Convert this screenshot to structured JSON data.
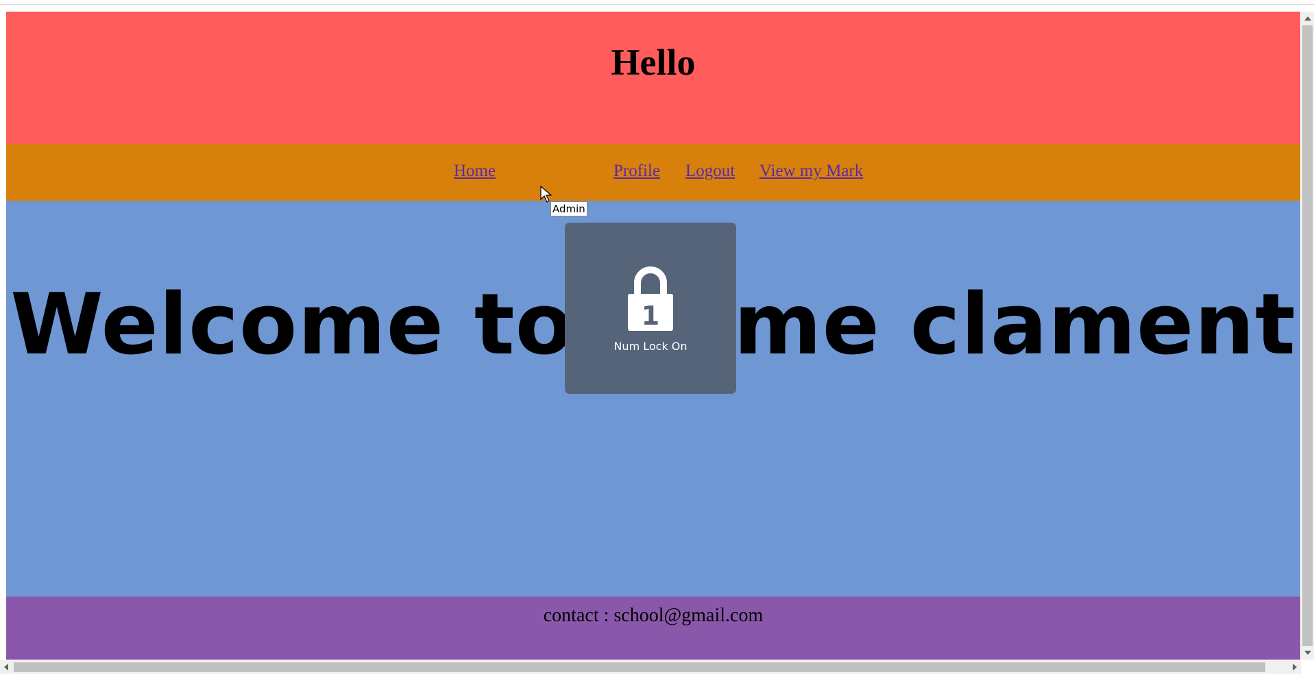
{
  "header": {
    "title": "Hello"
  },
  "nav": {
    "links": [
      {
        "label": "Home"
      },
      {
        "label": "Profile"
      },
      {
        "label": "Logout"
      },
      {
        "label": "View my Mark"
      }
    ],
    "tooltip": "Admin"
  },
  "main": {
    "heading": "Welcome to Home clament"
  },
  "osd": {
    "label": "Num Lock On",
    "icon": "lock-icon",
    "digit": "1"
  },
  "footer": {
    "contact": "contact : school@gmail.com"
  },
  "colors": {
    "header_bg": "#ff5c5c",
    "nav_bg": "#d8800c",
    "main_bg": "#6e97d4",
    "footer_bg": "#8a58aa",
    "link": "#5b2ba6",
    "osd_bg": "#566479"
  }
}
